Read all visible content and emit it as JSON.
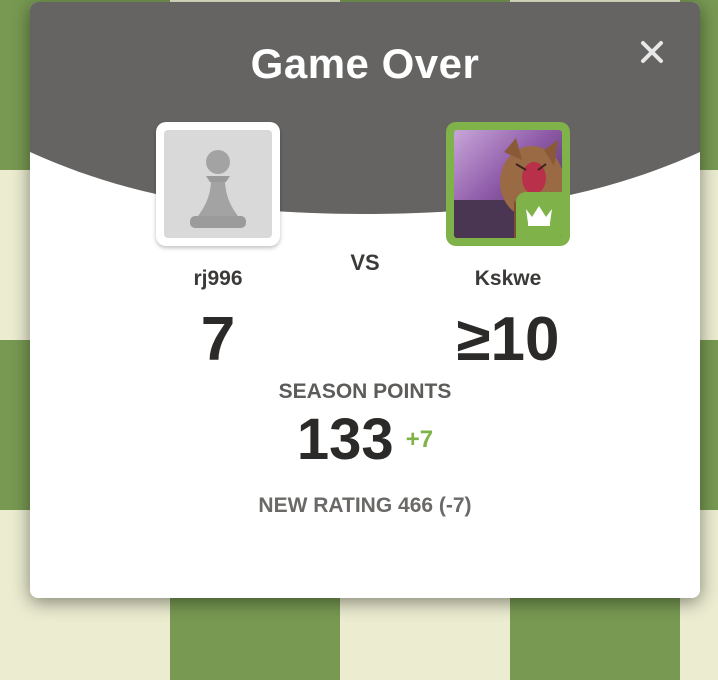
{
  "modal": {
    "title": "Game Over",
    "close_icon": "close-icon"
  },
  "players": {
    "left": {
      "name": "rj996",
      "score": "7",
      "avatar_icon": "pawn-icon"
    },
    "vs": "VS",
    "right": {
      "name": "Kskwe",
      "score": "≥10",
      "avatar_icon": "cat-photo",
      "badge_icon": "crown-icon"
    }
  },
  "season": {
    "label": "SEASON POINTS",
    "value": "133",
    "delta": "+7"
  },
  "rating": {
    "text": "NEW RATING 466 (-7)"
  },
  "colors": {
    "header": "#656463",
    "accent_green": "#7fb34a",
    "board_dark": "#779952",
    "board_light": "#ebecd0"
  }
}
